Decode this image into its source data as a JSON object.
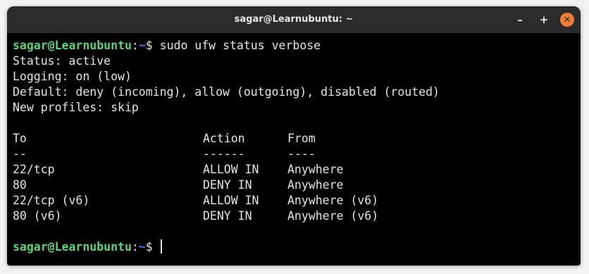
{
  "window": {
    "title": "sagar@Learnubuntu: ~",
    "minimize_glyph": "–",
    "maximize_glyph": "+",
    "close_glyph": "✕"
  },
  "prompt": {
    "user_host": "sagar@Learnubuntu",
    "separator": ":",
    "path": "~",
    "symbol": "$ "
  },
  "command": "sudo ufw status verbose",
  "status_lines": [
    "Status: active",
    "Logging: on (low)",
    "Default: deny (incoming), allow (outgoing), disabled (routed)",
    "New profiles: skip"
  ],
  "table": {
    "headers": [
      "To",
      "Action",
      "From"
    ],
    "dashes": [
      "--",
      "------",
      "----"
    ],
    "rows": [
      [
        "22/tcp",
        "ALLOW IN",
        "Anywhere"
      ],
      [
        "80",
        "DENY IN",
        "Anywhere"
      ],
      [
        "22/tcp (v6)",
        "ALLOW IN",
        "Anywhere (v6)"
      ],
      [
        "80 (v6)",
        "DENY IN",
        "Anywhere (v6)"
      ]
    ]
  },
  "colors": {
    "prompt_user": "#5fd17a",
    "prompt_path": "#4a78ff",
    "close_button": "#ef7b3a"
  }
}
